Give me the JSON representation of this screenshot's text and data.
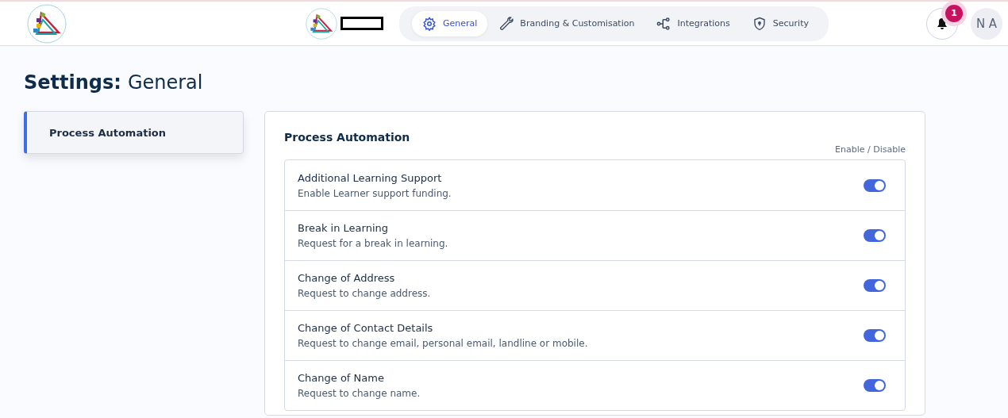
{
  "header": {
    "tabs": [
      {
        "label": "General",
        "kind": "gear",
        "selected": true
      },
      {
        "label": "Branding & Customisation",
        "kind": "wrench",
        "selected": false
      },
      {
        "label": "Integrations",
        "kind": "nodes",
        "selected": false
      },
      {
        "label": "Security",
        "kind": "shield",
        "selected": false
      }
    ],
    "notification_count": "1",
    "avatar_initials": "N A"
  },
  "page_title": {
    "prefix": "Settings:",
    "section": "General"
  },
  "sidebar": {
    "items": [
      {
        "label": "Process Automation",
        "selected": true
      }
    ]
  },
  "panel": {
    "title": "Process Automation",
    "column_label": "Enable / Disable",
    "settings": [
      {
        "name": "Additional Learning Support",
        "description": "Enable Learner support funding.",
        "on": true
      },
      {
        "name": "Break in Learning",
        "description": "Request for a break in learning.",
        "on": true
      },
      {
        "name": "Change of Address",
        "description": "Request to change address.",
        "on": true
      },
      {
        "name": "Change of Contact Details",
        "description": "Request to change email, personal email, landline or mobile.",
        "on": true
      },
      {
        "name": "Change of Name",
        "description": "Request to change name.",
        "on": true
      }
    ]
  }
}
